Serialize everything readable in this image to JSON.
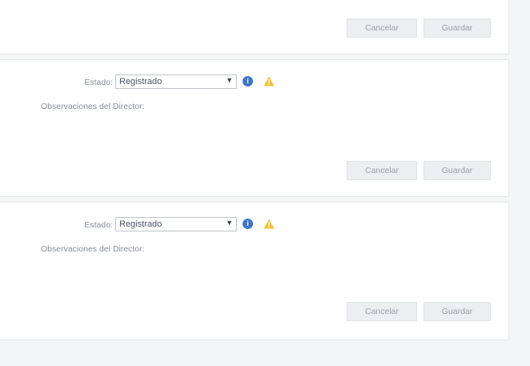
{
  "panels": [
    {
      "cancel_label": "Cancelar",
      "save_label": "Guardar"
    },
    {
      "estado_label": "Estado:",
      "estado_value": "Registrado",
      "observaciones_label": "Observaciones del Director:",
      "cancel_label": "Cancelar",
      "save_label": "Guardar"
    },
    {
      "estado_label": "Estado:",
      "estado_value": "Registrado",
      "observaciones_label": "Observaciones del Director:",
      "cancel_label": "Cancelar",
      "save_label": "Guardar"
    }
  ],
  "icons": {
    "info": "info-icon",
    "warning": "warning-icon",
    "dropdown": "chevron-down-icon"
  },
  "colors": {
    "info_blue": "#3b77c9",
    "warning_yellow": "#f2c12e",
    "button_bg": "#eceef0",
    "page_bg": "#f4f5f6"
  }
}
